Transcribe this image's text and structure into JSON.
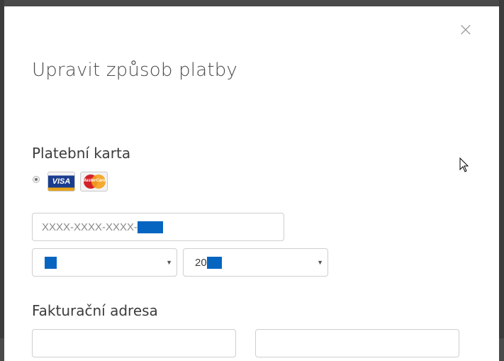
{
  "modal": {
    "title": "Upravit způsob platby",
    "close_glyph": "×"
  },
  "payment_card": {
    "heading": "Platební karta",
    "radio_selected": true,
    "logos": [
      {
        "name": "visa",
        "text": "VISA"
      },
      {
        "name": "mastercard",
        "text": "MasterCard"
      }
    ],
    "card_number_visible": "XXXX-XXXX-XXXX-",
    "expiry_month_value": "",
    "expiry_year_prefix": "20"
  },
  "billing": {
    "heading": "Fakturační adresa"
  },
  "colors": {
    "redaction": "#0565c0",
    "backdrop": "#4a4a4a"
  },
  "icons": {
    "close": "close-icon",
    "dropdown": "chevron-down-icon",
    "cursor": "mouse-pointer-icon"
  }
}
